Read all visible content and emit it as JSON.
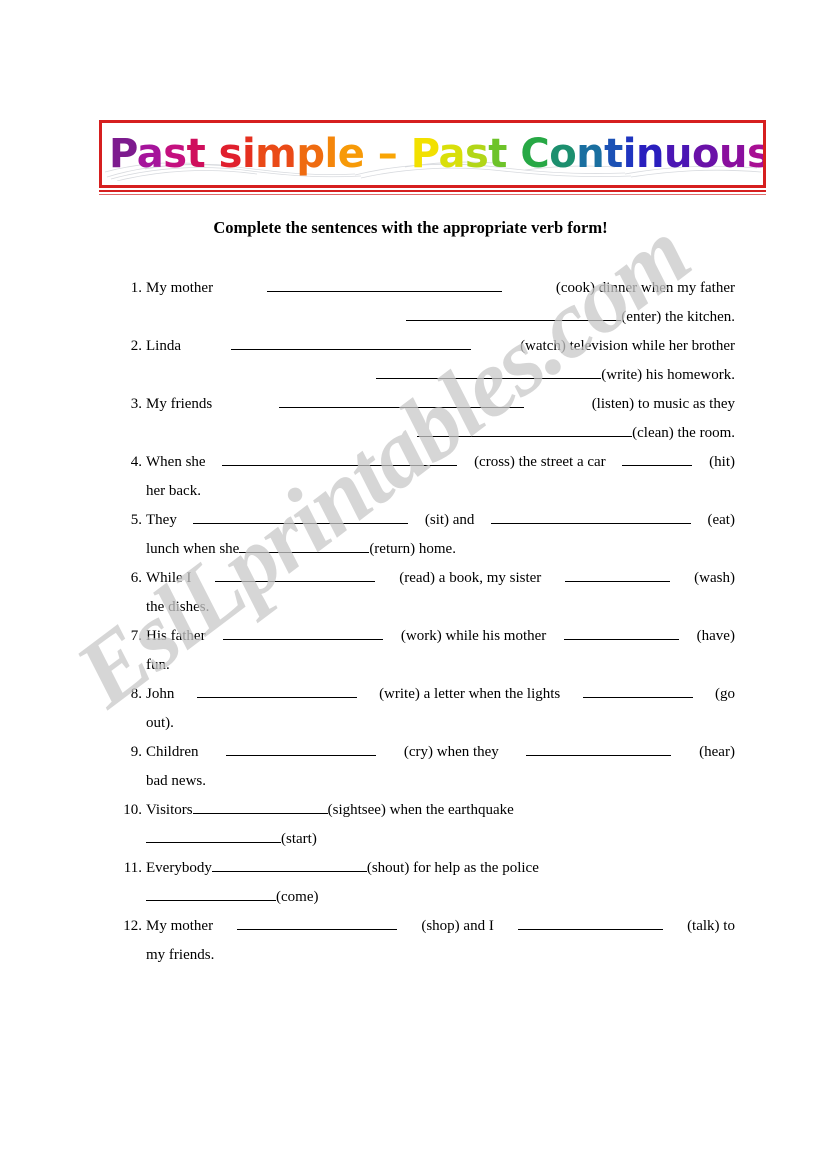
{
  "document": {
    "type": "esl-worksheet",
    "page_background": "#ffffff"
  },
  "banner": {
    "border_color": "#d61f1f",
    "title_parts": [
      {
        "text": "P",
        "color": "#7d1b8e"
      },
      {
        "text": "a",
        "color": "#a5149b"
      },
      {
        "text": "s",
        "color": "#c4107f"
      },
      {
        "text": "t",
        "color": "#cf0f5c"
      },
      {
        "text": " ",
        "color": "#cf0f5c"
      },
      {
        "text": "s",
        "color": "#e01f2d"
      },
      {
        "text": "i",
        "color": "#e5301f"
      },
      {
        "text": "m",
        "color": "#ea4a17"
      },
      {
        "text": "p",
        "color": "#ef6b10"
      },
      {
        "text": "l",
        "color": "#f4860b"
      },
      {
        "text": "e",
        "color": "#f79a08"
      },
      {
        "text": " ",
        "color": "#f79a08"
      },
      {
        "text": "–",
        "color": "#f9a505"
      },
      {
        "text": " ",
        "color": "#f9a505"
      },
      {
        "text": "P",
        "color": "#f2e000"
      },
      {
        "text": "a",
        "color": "#d9df0a"
      },
      {
        "text": "s",
        "color": "#b2d617"
      },
      {
        "text": "t",
        "color": "#6ec32a"
      },
      {
        "text": " ",
        "color": "#6ec32a"
      },
      {
        "text": "C",
        "color": "#27a845"
      },
      {
        "text": "o",
        "color": "#1c8f6e"
      },
      {
        "text": "n",
        "color": "#1a6fa0"
      },
      {
        "text": "t",
        "color": "#1b51b5"
      },
      {
        "text": "i",
        "color": "#1f35c0"
      },
      {
        "text": "n",
        "color": "#2a1fbe"
      },
      {
        "text": "u",
        "color": "#4b16b4"
      },
      {
        "text": "o",
        "color": "#6a11a8"
      },
      {
        "text": "u",
        "color": "#8a0f9e"
      },
      {
        "text": "s",
        "color": "#a80f93"
      }
    ]
  },
  "instruction": {
    "text": "Complete the sentences with the appropriate verb form!"
  },
  "watermark": {
    "text": "EslLprintables.com"
  },
  "exercise": {
    "items": [
      {
        "number": "1.",
        "line1_a": "My   mother",
        "line1_cue": "(cook)   dinner   when   my   father",
        "line2_cue": "(enter) the kitchen."
      },
      {
        "number": "2.",
        "line1_a": "Linda",
        "line1_cue": "(watch)   television   while   her   brother",
        "line2_cue": "(write) his homework."
      },
      {
        "number": "3.",
        "line1_a": "My    friends",
        "line1_cue": "(listen)   to   music   as   they",
        "line2_cue": "(clean) the room."
      },
      {
        "number": "4.",
        "line1_a": "When she",
        "line1_mid": "(cross) the street a car",
        "line1_cue": "(hit)",
        "line2_text": "her back."
      },
      {
        "number": "5.",
        "line1_a": "They",
        "line1_mid": "(sit) and",
        "line1_cue": "(eat)",
        "line2_a": "lunch when she",
        "line2_cue": "(return) home."
      },
      {
        "number": "6.",
        "line1_a": "While I",
        "line1_mid": "(read) a book, my sister",
        "line1_cue": "(wash)",
        "line2_text": "the dishes."
      },
      {
        "number": "7.",
        "line1_a": "His father",
        "line1_mid": "(work) while his mother",
        "line1_cue": "(have)",
        "line2_text": "fun."
      },
      {
        "number": "8.",
        "line1_a": "John",
        "line1_mid": "(write) a letter when the lights",
        "line1_cue": "(go",
        "line2_text": "out)."
      },
      {
        "number": "9.",
        "line1_a": "Children",
        "line1_mid": "(cry) when they",
        "line1_cue": "(hear)",
        "line2_text": "bad news."
      },
      {
        "number": "10.",
        "line1_a": "Visitors",
        "line1_cue": "(sightsee) when the earthquake",
        "line2_cue": "(start)"
      },
      {
        "number": "11.",
        "line1_a": "Everybody",
        "line1_cue": "(shout) for help as the police",
        "line2_cue": "(come)"
      },
      {
        "number": "12.",
        "line1_a": "My mother",
        "line1_mid": "(shop) and I",
        "line1_cue": "(talk) to",
        "line2_text": "my friends."
      }
    ]
  }
}
